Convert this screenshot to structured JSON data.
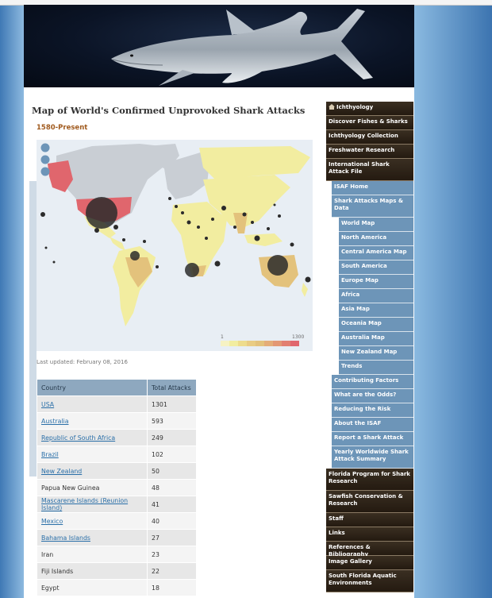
{
  "page": {
    "title": "Map of World's Confirmed Unprovoked Shark Attacks",
    "subtitle": "1580-Present",
    "last_updated": "Last updated: February 08, 2016"
  },
  "map": {
    "legend_min": "1",
    "legend_max": "1300",
    "zoom_controls": [
      "zoom-in",
      "zoom-out",
      "reset"
    ],
    "colors": {
      "ocean": "#e8eef4",
      "land_no_data": "#c9ced4",
      "low": "#f2eda0",
      "mid": "#e3c27c",
      "high": "#e0666d",
      "bubble": "#2b2b2b"
    }
  },
  "table": {
    "headers": [
      "Country",
      "Total Attacks"
    ],
    "rows": [
      {
        "country": "USA",
        "attacks": "1301",
        "link": true
      },
      {
        "country": "Australia",
        "attacks": "593",
        "link": true
      },
      {
        "country": "Republic of South Africa",
        "attacks": "249",
        "link": true
      },
      {
        "country": "Brazil",
        "attacks": "102",
        "link": true
      },
      {
        "country": "New Zealand",
        "attacks": "50",
        "link": true
      },
      {
        "country": "Papua New Guinea",
        "attacks": "48",
        "link": false
      },
      {
        "country": "Mascarene Islands (Reunion Island)",
        "attacks": "41",
        "link": true
      },
      {
        "country": "Mexico",
        "attacks": "40",
        "link": true
      },
      {
        "country": "Bahama Islands",
        "attacks": "27",
        "link": true
      },
      {
        "country": "Iran",
        "attacks": "23",
        "link": false
      },
      {
        "country": "Fiji Islands",
        "attacks": "22",
        "link": false
      },
      {
        "country": "Egypt",
        "attacks": "18",
        "link": false
      }
    ]
  },
  "nav": {
    "items": [
      {
        "label": "Ichthyology",
        "level": 1,
        "icon": "home-icon"
      },
      {
        "label": "Discover Fishes & Sharks",
        "level": 1
      },
      {
        "label": "Ichthyology Collection",
        "level": 1
      },
      {
        "label": "Freshwater Research",
        "level": 1
      },
      {
        "label": "International Shark Attack File",
        "level": 1
      },
      {
        "label": "ISAF Home",
        "level": 2
      },
      {
        "label": "Shark Attacks Maps & Data",
        "level": 2
      },
      {
        "label": "World Map",
        "level": 3
      },
      {
        "label": "North America",
        "level": 3
      },
      {
        "label": "Central America Map",
        "level": 3
      },
      {
        "label": "South America",
        "level": 3
      },
      {
        "label": "Europe Map",
        "level": 3
      },
      {
        "label": "Africa",
        "level": 3
      },
      {
        "label": "Asia Map",
        "level": 3
      },
      {
        "label": "Oceania Map",
        "level": 3
      },
      {
        "label": "Australia Map",
        "level": 3
      },
      {
        "label": "New Zealand Map",
        "level": 3
      },
      {
        "label": "Trends",
        "level": 3
      },
      {
        "label": "Contributing Factors",
        "level": 2
      },
      {
        "label": "What are the Odds?",
        "level": 2
      },
      {
        "label": "Reducing the Risk",
        "level": 2
      },
      {
        "label": "About the ISAF",
        "level": 2
      },
      {
        "label": "Report a Shark Attack",
        "level": 2
      },
      {
        "label": "Yearly Worldwide Shark Attack Summary",
        "level": 2
      },
      {
        "label": "Florida Program for Shark Research",
        "level": 1
      },
      {
        "label": "Sawfish Conservation & Research",
        "level": 1
      },
      {
        "label": "Staff",
        "level": 1
      },
      {
        "label": "Links",
        "level": 1
      },
      {
        "label": "References & Bibliography",
        "level": 1
      },
      {
        "label": "Image Gallery",
        "level": 1
      },
      {
        "label": "South Florida Aquatic Environments",
        "level": 1
      }
    ]
  }
}
